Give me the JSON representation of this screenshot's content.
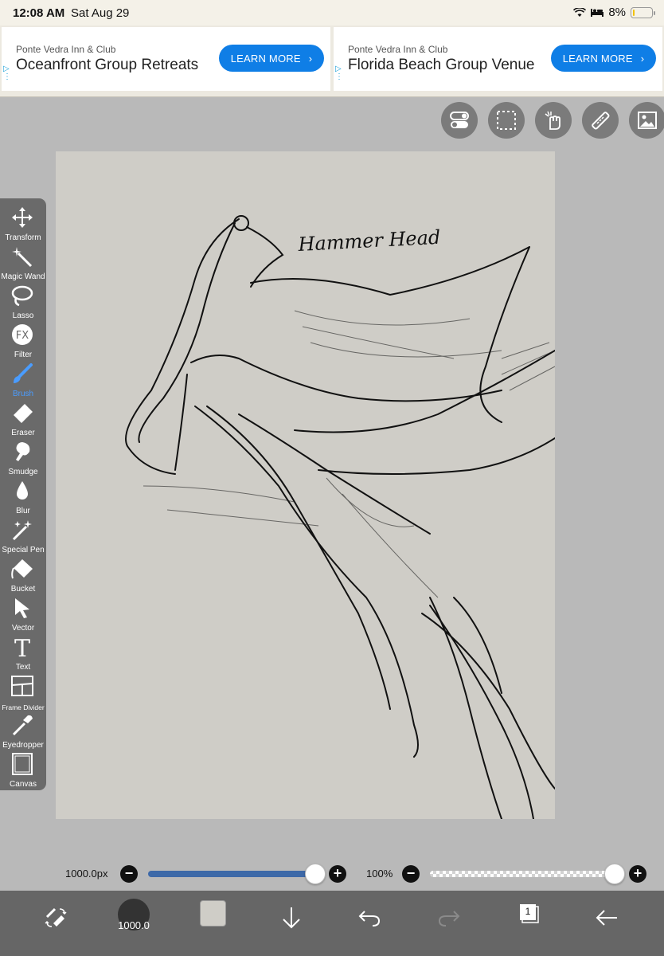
{
  "statusbar": {
    "time": "12:08 AM",
    "date": "Sat Aug 29",
    "battery": "8%"
  },
  "ads": [
    {
      "sponsor": "Ponte Vedra Inn & Club",
      "headline": "Oceanfront Group Retreats",
      "cta": "LEARN MORE"
    },
    {
      "sponsor": "Ponte Vedra Inn & Club",
      "headline": "Florida Beach Group Venue",
      "cta": "LEARN MORE"
    }
  ],
  "top_buttons": [
    "toggle-icon",
    "selection-icon",
    "hand-icon",
    "ruler-icon",
    "image-icon"
  ],
  "canvas": {
    "annotation": "Hammer Head",
    "background": "#cfcdc7"
  },
  "tools": [
    {
      "label": "Transform"
    },
    {
      "label": "Magic Wand"
    },
    {
      "label": "Lasso"
    },
    {
      "label": "Filter"
    },
    {
      "label": "Brush"
    },
    {
      "label": "Eraser"
    },
    {
      "label": "Smudge"
    },
    {
      "label": "Blur"
    },
    {
      "label": "Special Pen"
    },
    {
      "label": "Bucket"
    },
    {
      "label": "Vector"
    },
    {
      "label": "Text"
    },
    {
      "label": "Frame Divider"
    },
    {
      "label": "Eyedropper"
    },
    {
      "label": "Canvas"
    }
  ],
  "active_tool": "Brush",
  "sliders": {
    "brush_size_label": "1000.0px",
    "brush_size_fraction": 1.0,
    "opacity_label": "100%",
    "opacity_fraction": 1.0
  },
  "bottombar": {
    "brush_size": "1000.0",
    "layer_count": "1"
  },
  "colors": {
    "accent": "#0f7ee6",
    "active_tool": "#4a9cff",
    "slider": "#3d69a8"
  }
}
